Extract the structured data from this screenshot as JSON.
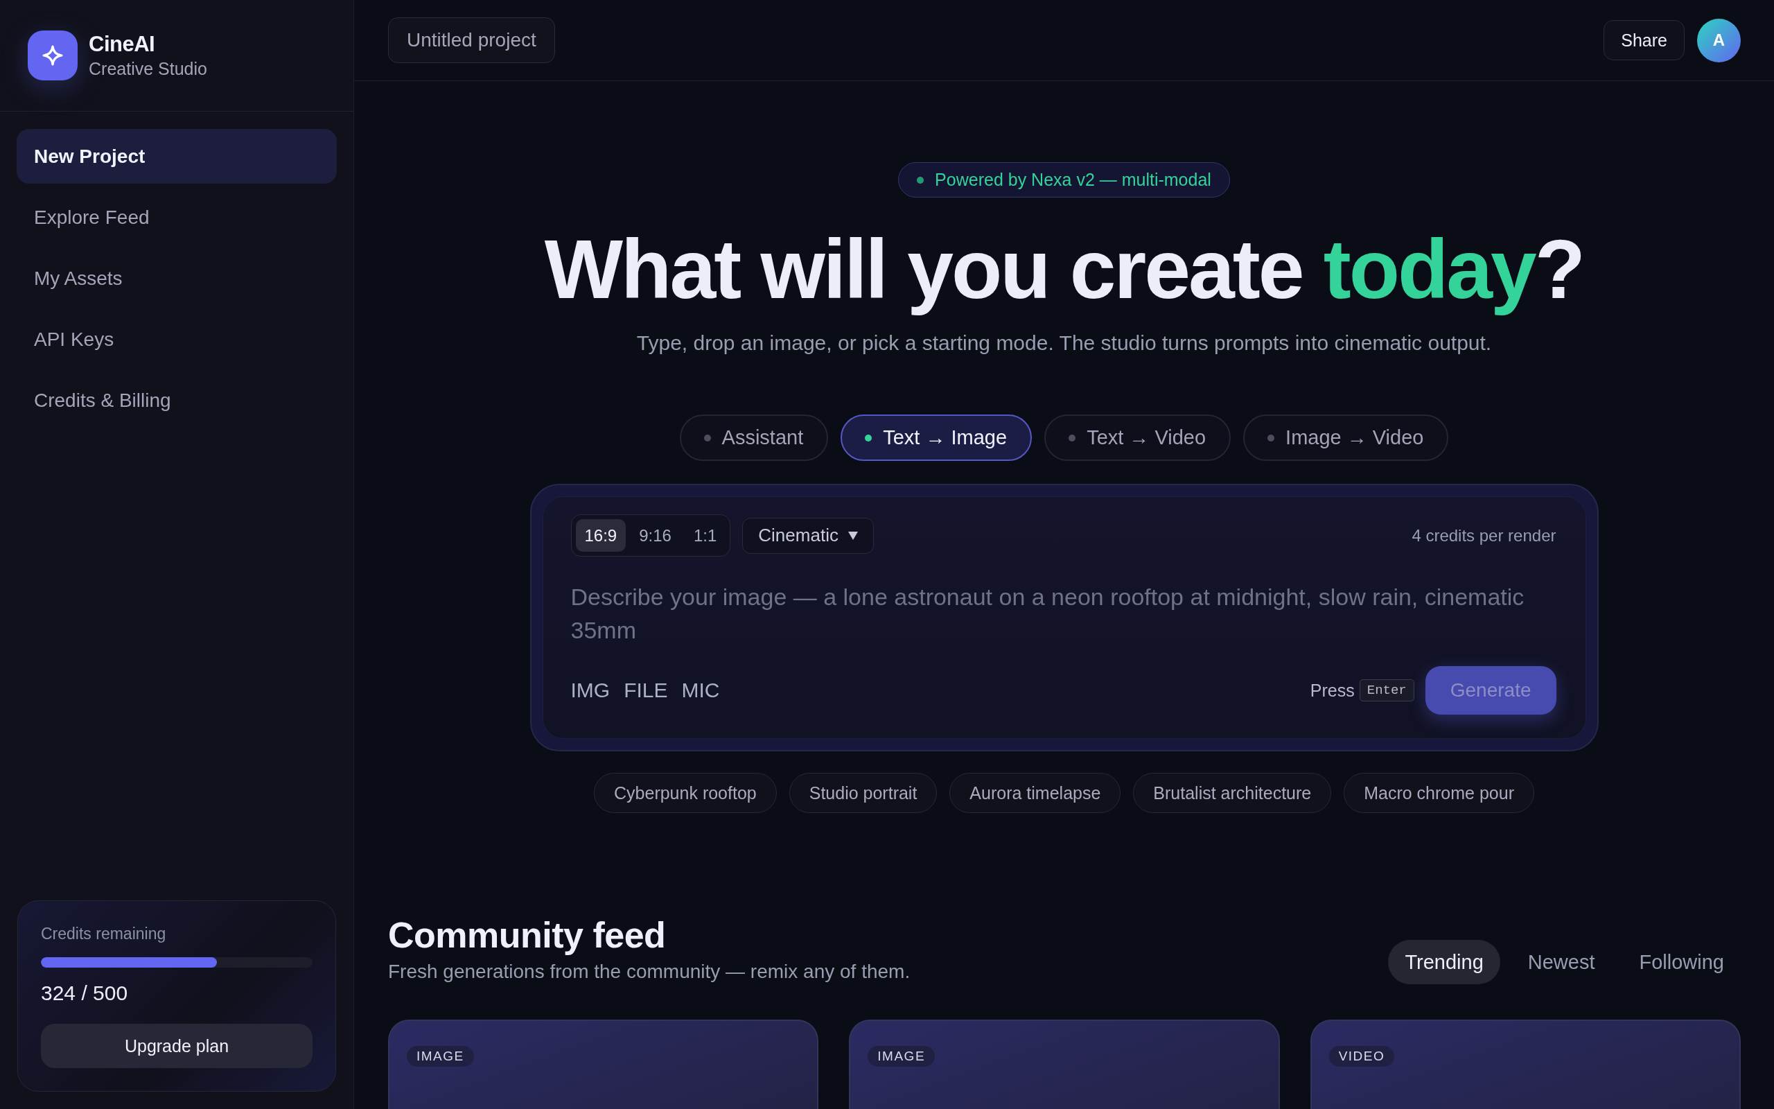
{
  "sidebar": {
    "brand": {
      "name": "CineAI",
      "tagline": "Creative Studio"
    },
    "nav": [
      {
        "label": "New Project",
        "selected": true
      },
      {
        "label": "Explore Feed",
        "selected": false
      },
      {
        "label": "My Assets",
        "selected": false
      },
      {
        "label": "API Keys",
        "selected": false
      },
      {
        "label": "Credits & Billing",
        "selected": false
      }
    ],
    "credits": {
      "label": "Credits remaining",
      "level": 0.648,
      "reading": "324 / 500",
      "button": "Upgrade plan"
    }
  },
  "topbar": {
    "project_name": "Untitled project",
    "share": "Share",
    "avatar": "A"
  },
  "hero": {
    "badge": "Powered by Nexa v2 — multi-modal",
    "headline": {
      "before": "What will you create ",
      "highlight": "today",
      "after": "?"
    },
    "subtitle": "Type, drop an image, or pick a starting mode. The studio turns prompts into cinematic output."
  },
  "modes": [
    {
      "label": "Assistant",
      "selected": false
    },
    {
      "label": "Text → Image",
      "selected": true
    },
    {
      "label": "Text → Video",
      "selected": false
    },
    {
      "label": "Image → Video",
      "selected": false
    }
  ],
  "composer": {
    "aspect_ratios": [
      {
        "label": "16:9",
        "selected": true
      },
      {
        "label": "9:16",
        "selected": false
      },
      {
        "label": "1:1",
        "selected": false
      }
    ],
    "style": "Cinematic",
    "cost": "4 credits per render",
    "prompt_placeholder": "Describe your image — a lone astronaut on a neon rooftop at midnight, slow rain, cinematic 35mm",
    "attachments": [
      "IMG",
      "FILE",
      "MIC"
    ],
    "hint": "Press",
    "key": "Enter",
    "generate": {
      "label": "Generate",
      "disabled": true
    }
  },
  "suggestions": [
    "Cyberpunk rooftop",
    "Studio portrait",
    "Aurora timelapse",
    "Brutalist architecture",
    "Macro chrome pour"
  ],
  "feed": {
    "title": "Community feed",
    "subtitle": "Fresh generations from the community — remix any of them.",
    "tabs": [
      {
        "label": "Trending",
        "selected": true
      },
      {
        "label": "Newest",
        "selected": false
      },
      {
        "label": "Following",
        "selected": false
      }
    ],
    "cards": [
      {
        "tag": "IMAGE"
      },
      {
        "tag": "IMAGE"
      },
      {
        "tag": "VIDEO"
      }
    ]
  }
}
